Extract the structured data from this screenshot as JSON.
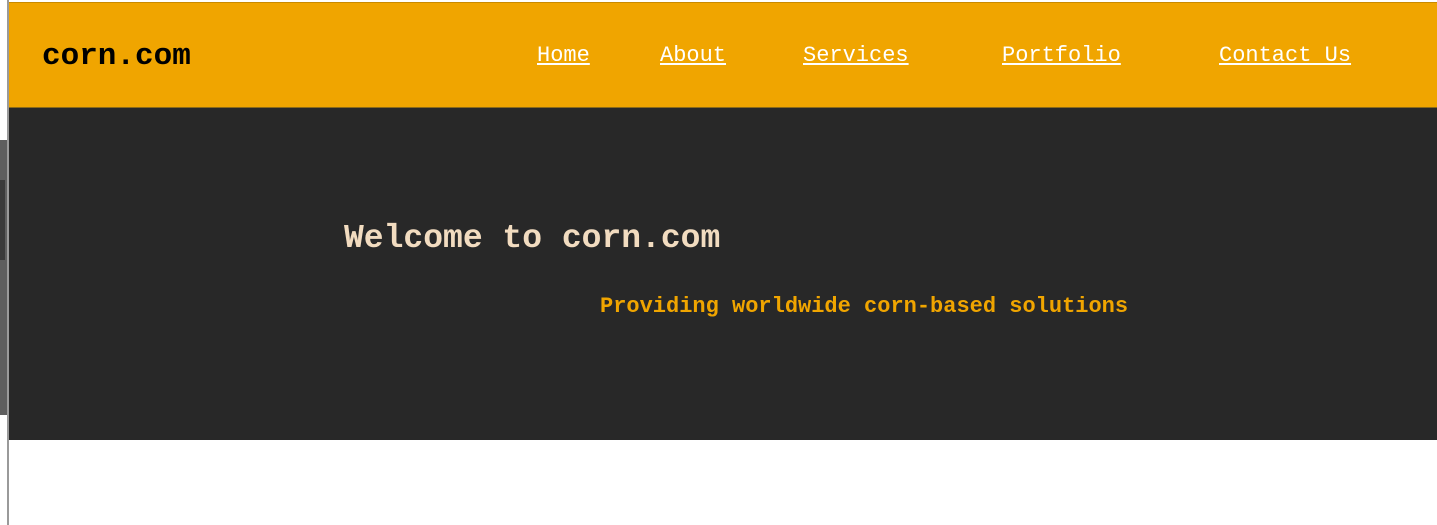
{
  "header": {
    "logo": "corn.com",
    "nav": [
      {
        "label": "Home"
      },
      {
        "label": "About"
      },
      {
        "label": "Services"
      },
      {
        "label": "Portfolio"
      },
      {
        "label": "Contact Us"
      }
    ]
  },
  "hero": {
    "title": "Welcome to corn.com",
    "subtitle": "Providing worldwide corn-based solutions"
  },
  "colors": {
    "header_bg": "#f0a500",
    "hero_bg": "#282828",
    "title_color": "#f2dcc0",
    "accent": "#f0a500"
  }
}
